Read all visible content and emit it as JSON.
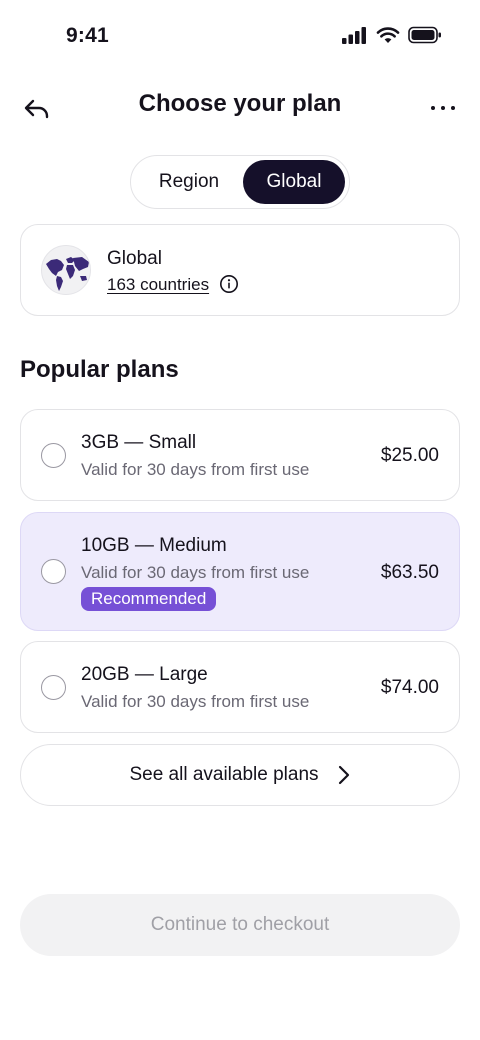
{
  "status_bar": {
    "time": "9:41"
  },
  "header": {
    "title": "Choose your plan"
  },
  "segmented": {
    "options": [
      "Region",
      "Global"
    ],
    "selected": "Global"
  },
  "region_card": {
    "name": "Global",
    "countries_link": "163 countries"
  },
  "section": {
    "title": "Popular plans"
  },
  "plans": [
    {
      "name": "3GB — Small",
      "validity": "Valid for 30 days from first use",
      "price": "$25.00",
      "selected": false
    },
    {
      "name": "10GB — Medium",
      "validity": "Valid for 30 days from first use",
      "price": "$63.50",
      "badge": "Recommended",
      "selected": false
    },
    {
      "name": "20GB — Large",
      "validity": "Valid for 30 days from first use",
      "price": "$74.00",
      "selected": false
    }
  ],
  "see_all": {
    "label": "See all available plans"
  },
  "checkout": {
    "label": "Continue to checkout",
    "enabled": false
  },
  "colors": {
    "accent": "#7650d6",
    "highlight_bg": "#eeebfc",
    "dark": "#15102a",
    "disabled_bg": "#f2f2f3",
    "disabled_text": "#a0a0a6"
  },
  "icons": [
    "back-arrow-icon",
    "more-icon",
    "globe-icon",
    "info-icon",
    "chevron-right-icon",
    "signal-icon",
    "wifi-icon",
    "battery-icon"
  ]
}
